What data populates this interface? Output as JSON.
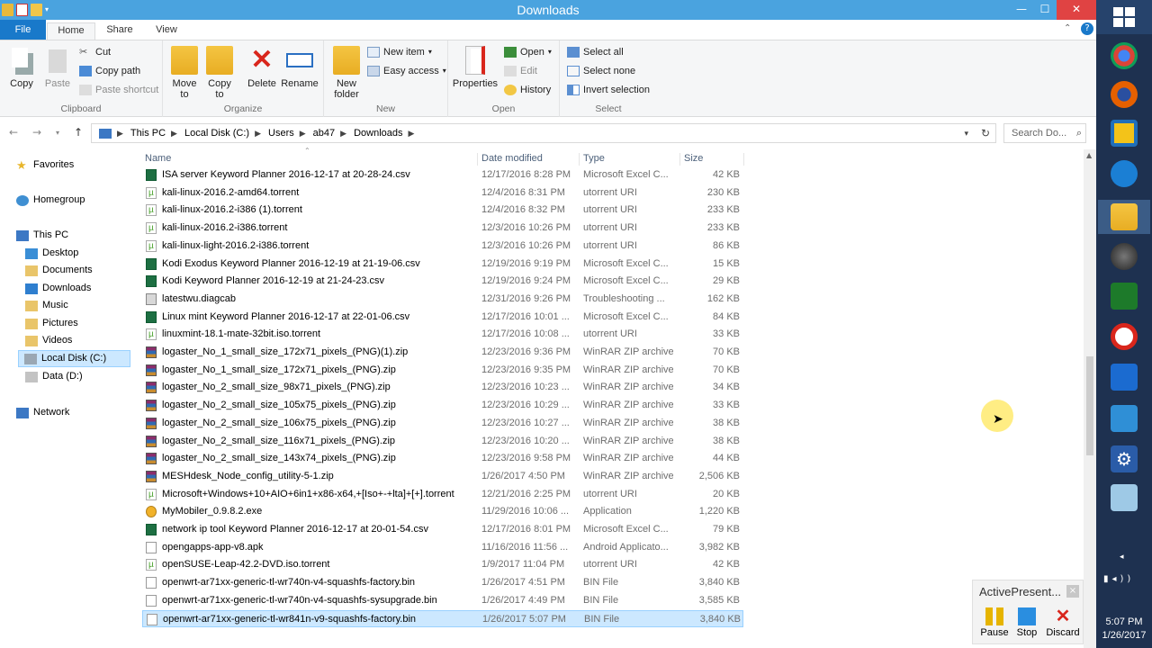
{
  "window": {
    "title": "Downloads",
    "minimize": "—",
    "maximize": "☐",
    "close": "✕"
  },
  "ribbon_tabs": {
    "file": "File",
    "home": "Home",
    "share": "Share",
    "view": "View"
  },
  "clipboard": {
    "copy": "Copy",
    "paste": "Paste",
    "cut": "Cut",
    "copy_path": "Copy path",
    "paste_shortcut": "Paste shortcut",
    "label": "Clipboard"
  },
  "organize": {
    "move_to_1": "Move",
    "move_to_2": "to",
    "copy_to_1": "Copy",
    "copy_to_2": "to",
    "delete": "Delete",
    "rename": "Rename",
    "label": "Organize"
  },
  "new": {
    "new_folder_1": "New",
    "new_folder_2": "folder",
    "new_item": "New item",
    "easy_access": "Easy access",
    "label": "New"
  },
  "open": {
    "properties": "Properties",
    "open": "Open",
    "edit": "Edit",
    "history": "History",
    "label": "Open"
  },
  "select": {
    "select_all": "Select all",
    "select_none": "Select none",
    "invert": "Invert selection",
    "label": "Select"
  },
  "address": {
    "crumbs": [
      "This PC",
      "Local Disk (C:)",
      "Users",
      "ab47",
      "Downloads"
    ],
    "search_placeholder": "Search Do..."
  },
  "nav": {
    "favorites": "Favorites",
    "homegroup": "Homegroup",
    "this_pc": "This PC",
    "desktop": "Desktop",
    "documents": "Documents",
    "downloads": "Downloads",
    "music": "Music",
    "pictures": "Pictures",
    "videos": "Videos",
    "local_disk": "Local Disk (C:)",
    "data": "Data (D:)",
    "network": "Network"
  },
  "columns": {
    "name": "Name",
    "date": "Date modified",
    "type": "Type",
    "size": "Size"
  },
  "files": [
    {
      "icon": "csv",
      "name": "ISA server Keyword Planner 2016-12-17 at 20-28-24.csv",
      "date": "12/17/2016 8:28 PM",
      "type": "Microsoft Excel C...",
      "size": "42 KB"
    },
    {
      "icon": "tor",
      "name": "kali-linux-2016.2-amd64.torrent",
      "date": "12/4/2016 8:31 PM",
      "type": "utorrent URI",
      "size": "230 KB"
    },
    {
      "icon": "tor",
      "name": "kali-linux-2016.2-i386 (1).torrent",
      "date": "12/4/2016 8:32 PM",
      "type": "utorrent URI",
      "size": "233 KB"
    },
    {
      "icon": "tor",
      "name": "kali-linux-2016.2-i386.torrent",
      "date": "12/3/2016 10:26 PM",
      "type": "utorrent URI",
      "size": "233 KB"
    },
    {
      "icon": "tor",
      "name": "kali-linux-light-2016.2-i386.torrent",
      "date": "12/3/2016 10:26 PM",
      "type": "utorrent URI",
      "size": "86 KB"
    },
    {
      "icon": "csv",
      "name": "Kodi Exodus Keyword Planner 2016-12-19 at 21-19-06.csv",
      "date": "12/19/2016 9:19 PM",
      "type": "Microsoft Excel C...",
      "size": "15 KB"
    },
    {
      "icon": "csv",
      "name": "Kodi Keyword Planner 2016-12-19 at 21-24-23.csv",
      "date": "12/19/2016 9:24 PM",
      "type": "Microsoft Excel C...",
      "size": "29 KB"
    },
    {
      "icon": "diag",
      "name": "latestwu.diagcab",
      "date": "12/31/2016 9:26 PM",
      "type": "Troubleshooting ...",
      "size": "162 KB"
    },
    {
      "icon": "csv",
      "name": "Linux mint Keyword Planner 2016-12-17 at 22-01-06.csv",
      "date": "12/17/2016 10:01 ...",
      "type": "Microsoft Excel C...",
      "size": "84 KB"
    },
    {
      "icon": "tor",
      "name": "linuxmint-18.1-mate-32bit.iso.torrent",
      "date": "12/17/2016 10:08 ...",
      "type": "utorrent URI",
      "size": "33 KB"
    },
    {
      "icon": "zip",
      "name": "logaster_No_1_small_size_172x71_pixels_(PNG)(1).zip",
      "date": "12/23/2016 9:36 PM",
      "type": "WinRAR ZIP archive",
      "size": "70 KB"
    },
    {
      "icon": "zip",
      "name": "logaster_No_1_small_size_172x71_pixels_(PNG).zip",
      "date": "12/23/2016 9:35 PM",
      "type": "WinRAR ZIP archive",
      "size": "70 KB"
    },
    {
      "icon": "zip",
      "name": "logaster_No_2_small_size_98x71_pixels_(PNG).zip",
      "date": "12/23/2016 10:23 ...",
      "type": "WinRAR ZIP archive",
      "size": "34 KB"
    },
    {
      "icon": "zip",
      "name": "logaster_No_2_small_size_105x75_pixels_(PNG).zip",
      "date": "12/23/2016 10:29 ...",
      "type": "WinRAR ZIP archive",
      "size": "33 KB"
    },
    {
      "icon": "zip",
      "name": "logaster_No_2_small_size_106x75_pixels_(PNG).zip",
      "date": "12/23/2016 10:27 ...",
      "type": "WinRAR ZIP archive",
      "size": "38 KB"
    },
    {
      "icon": "zip",
      "name": "logaster_No_2_small_size_116x71_pixels_(PNG).zip",
      "date": "12/23/2016 10:20 ...",
      "type": "WinRAR ZIP archive",
      "size": "38 KB"
    },
    {
      "icon": "zip",
      "name": "logaster_No_2_small_size_143x74_pixels_(PNG).zip",
      "date": "12/23/2016 9:58 PM",
      "type": "WinRAR ZIP archive",
      "size": "44 KB"
    },
    {
      "icon": "zip",
      "name": "MESHdesk_Node_config_utility-5-1.zip",
      "date": "1/26/2017 4:50 PM",
      "type": "WinRAR ZIP archive",
      "size": "2,506 KB"
    },
    {
      "icon": "tor",
      "name": "Microsoft+Windows+10+AIO+6in1+x86-x64,+[Iso+-+lta]+[+].torrent",
      "date": "12/21/2016 2:25 PM",
      "type": "utorrent URI",
      "size": "20 KB"
    },
    {
      "icon": "exe",
      "name": "MyMobiler_0.9.8.2.exe",
      "date": "11/29/2016 10:06 ...",
      "type": "Application",
      "size": "1,220 KB"
    },
    {
      "icon": "csv",
      "name": "network ip tool Keyword Planner 2016-12-17 at 20-01-54.csv",
      "date": "12/17/2016 8:01 PM",
      "type": "Microsoft Excel C...",
      "size": "79 KB"
    },
    {
      "icon": "blank",
      "name": "opengapps-app-v8.apk",
      "date": "11/16/2016 11:56 ...",
      "type": "Android Applicato...",
      "size": "3,982 KB"
    },
    {
      "icon": "tor",
      "name": "openSUSE-Leap-42.2-DVD.iso.torrent",
      "date": "1/9/2017 11:04 PM",
      "type": "utorrent URI",
      "size": "42 KB"
    },
    {
      "icon": "blank",
      "name": "openwrt-ar71xx-generic-tl-wr740n-v4-squashfs-factory.bin",
      "date": "1/26/2017 4:51 PM",
      "type": "BIN File",
      "size": "3,840 KB"
    },
    {
      "icon": "blank",
      "name": "openwrt-ar71xx-generic-tl-wr740n-v4-squashfs-sysupgrade.bin",
      "date": "1/26/2017 4:49 PM",
      "type": "BIN File",
      "size": "3,585 KB"
    },
    {
      "icon": "blank",
      "name": "openwrt-ar71xx-generic-tl-wr841n-v9-squashfs-factory.bin",
      "date": "1/26/2017 5:07 PM",
      "type": "BIN File",
      "size": "3,840 KB",
      "selected": true
    }
  ],
  "activepresenter": {
    "title": "ActivePresent...",
    "close": "×",
    "pause": "Pause",
    "stop": "Stop",
    "discard": "Discard"
  },
  "clock": {
    "time": "5:07 PM",
    "date": "1/26/2017"
  },
  "colors": {
    "accent": "#1979ca",
    "titlebar": "#4aa3df",
    "selection": "#cce8ff",
    "taskbar": "#1e3150"
  }
}
